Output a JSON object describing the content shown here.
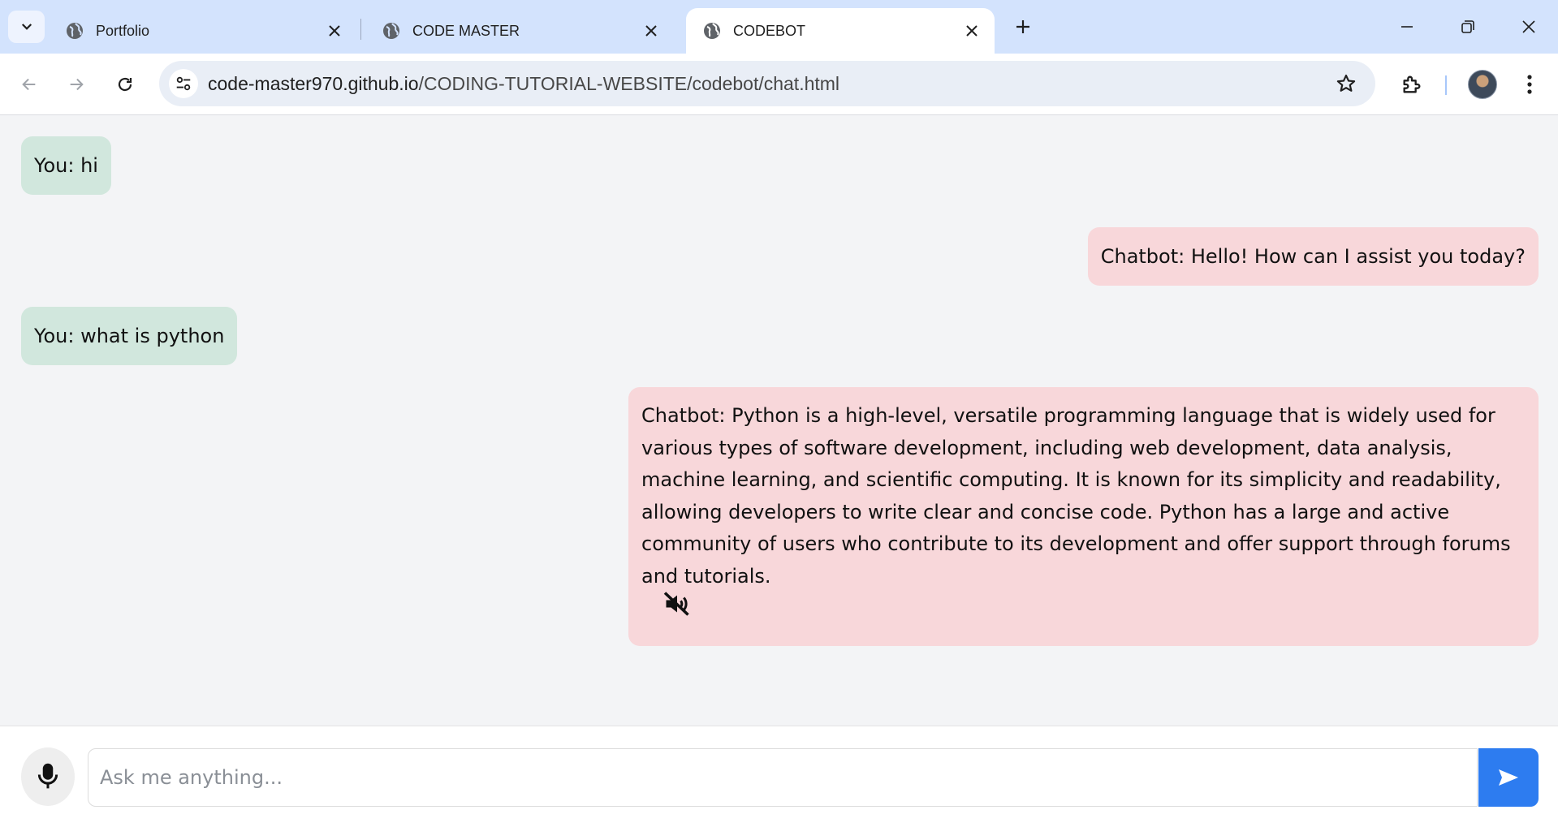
{
  "browser": {
    "tabs": [
      {
        "title": "Portfolio",
        "active": false,
        "icon": "globe-icon"
      },
      {
        "title": "CODE MASTER",
        "active": false,
        "icon": "globe-icon"
      },
      {
        "title": "CODEBOT",
        "active": true,
        "icon": "globe-icon"
      }
    ],
    "url_host": "code-master970.github.io",
    "url_path": "/CODING-TUTORIAL-WEBSITE/codebot/chat.html",
    "colors": {
      "tabstrip": "#d3e3fd",
      "omnibox": "#e9eef6"
    }
  },
  "chat": {
    "messages": [
      {
        "sender": "user",
        "text": "You: hi"
      },
      {
        "sender": "bot",
        "text": "Chatbot: Hello! How can I assist you today?"
      },
      {
        "sender": "user",
        "text": "You: what is python"
      },
      {
        "sender": "bot",
        "text": "Chatbot: Python is a high-level, versatile programming language that is widely used for various types of software development, including web development, data analysis, machine learning, and scientific computing. It is known for its simplicity and readability, allowing developers to write clear and concise code. Python has a large and active community of users who contribute to its development and offer support through forums and tutorials.",
        "audio_icon": "speaker-muted-icon"
      }
    ],
    "colors": {
      "user_bubble": "#d1e7dd",
      "bot_bubble": "#f8d7da",
      "send_button": "#2d7cf0"
    }
  },
  "input": {
    "placeholder": "Ask me anything...",
    "value": "",
    "mic_icon": "microphone-icon",
    "send_icon": "send-icon"
  }
}
